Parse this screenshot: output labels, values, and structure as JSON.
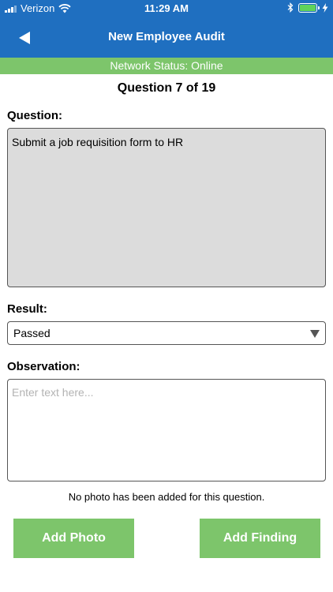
{
  "status_bar": {
    "carrier": "Verizon",
    "time": "11:29 AM",
    "battery_percent": 100
  },
  "nav": {
    "title": "New Employee Audit"
  },
  "network_status": "Network Status: Online",
  "question_counter": "Question 7 of 19",
  "question": {
    "label": "Question:",
    "text": "Submit a job requisition form to HR"
  },
  "result": {
    "label": "Result:",
    "selected": "Passed"
  },
  "observation": {
    "label": "Observation:",
    "value": "",
    "placeholder": "Enter text here..."
  },
  "photo_note": "No photo has been added for this question.",
  "buttons": {
    "add_photo": "Add Photo",
    "add_finding": "Add Finding"
  },
  "colors": {
    "header_blue": "#1f6fc0",
    "accent_green": "#7dc56b",
    "question_bg": "#dcdcdc"
  }
}
